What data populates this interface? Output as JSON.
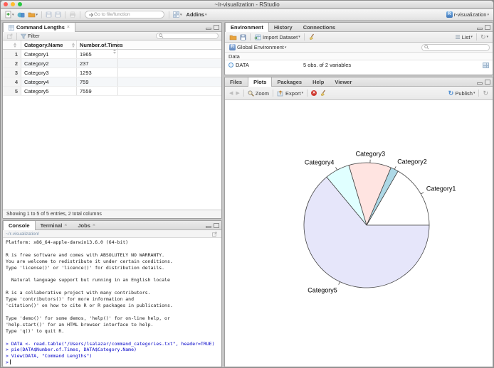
{
  "window": {
    "title": "~/r-visualization - RStudio",
    "project": "r-visualization"
  },
  "toolbar": {
    "goto_placeholder": "Go to file/function",
    "addins": "Addins"
  },
  "data_viewer": {
    "tab": "Command Lengths",
    "filter": "Filter",
    "col_name": "Category.Name",
    "col_times": "Number.of.Times",
    "rows": [
      {
        "n": "1",
        "name": "Category1",
        "times": "1965"
      },
      {
        "n": "2",
        "name": "Category2",
        "times": "237"
      },
      {
        "n": "3",
        "name": "Category3",
        "times": "1293"
      },
      {
        "n": "4",
        "name": "Category4",
        "times": "759"
      },
      {
        "n": "5",
        "name": "Category5",
        "times": "7559"
      }
    ],
    "status": "Showing 1 to 5 of 5 entries, 2 total columns"
  },
  "console": {
    "tabs": [
      "Console",
      "Terminal",
      "Jobs"
    ],
    "path": "~/r-visualization/",
    "lines": [
      {
        "text": "Platform: x86_64-apple-darwin13.6.0 (64-bit)",
        "input": false
      },
      {
        "text": "",
        "input": false
      },
      {
        "text": "R is free software and comes with ABSOLUTELY NO WARRANTY.",
        "input": false
      },
      {
        "text": "You are welcome to redistribute it under certain conditions.",
        "input": false
      },
      {
        "text": "Type 'license()' or 'licence()' for distribution details.",
        "input": false
      },
      {
        "text": "",
        "input": false
      },
      {
        "text": "  Natural language support but running in an English locale",
        "input": false
      },
      {
        "text": "",
        "input": false
      },
      {
        "text": "R is a collaborative project with many contributors.",
        "input": false
      },
      {
        "text": "Type 'contributors()' for more information and",
        "input": false
      },
      {
        "text": "'citation()' on how to cite R or R packages in publications.",
        "input": false
      },
      {
        "text": "",
        "input": false
      },
      {
        "text": "Type 'demo()' for some demos, 'help()' for on-line help, or",
        "input": false
      },
      {
        "text": "'help.start()' for an HTML browser interface to help.",
        "input": false
      },
      {
        "text": "Type 'q()' to quit R.",
        "input": false
      },
      {
        "text": "",
        "input": false
      },
      {
        "text": "> DATA <- read.table(\"/Users/lsalazar/command_categories.txt\", header=TRUE)",
        "input": true
      },
      {
        "text": "> pie(DATA$Number.of.Times, DATA$Category.Name)",
        "input": true
      },
      {
        "text": "> View(DATA, \"Command Lengths\")",
        "input": true
      }
    ],
    "prompt": ">"
  },
  "environment": {
    "tabs": [
      "Environment",
      "History",
      "Connections"
    ],
    "import_dataset": "Import Dataset",
    "list": "List",
    "scope": "Global Environment",
    "section": "Data",
    "object": {
      "name": "DATA",
      "desc": "5 obs. of 2 variables"
    }
  },
  "plots": {
    "tabs": [
      "Files",
      "Plots",
      "Packages",
      "Help",
      "Viewer"
    ],
    "zoom": "Zoom",
    "export": "Export",
    "publish": "Publish"
  },
  "chart_data": {
    "type": "pie",
    "title": "",
    "categories": [
      "Category1",
      "Category2",
      "Category3",
      "Category4",
      "Category5"
    ],
    "values": [
      1965,
      237,
      1293,
      759,
      7559
    ],
    "colors": [
      "#FFFFFF",
      "#ADD8E6",
      "#FFE4E1",
      "#E0FFFF",
      "#E6E6FA"
    ],
    "start_angle_deg": 0,
    "direction": "counterclockwise",
    "legend": "none"
  },
  "colors": {
    "command_text": "#0000C8",
    "publish_accent": "#4C8DD2"
  }
}
